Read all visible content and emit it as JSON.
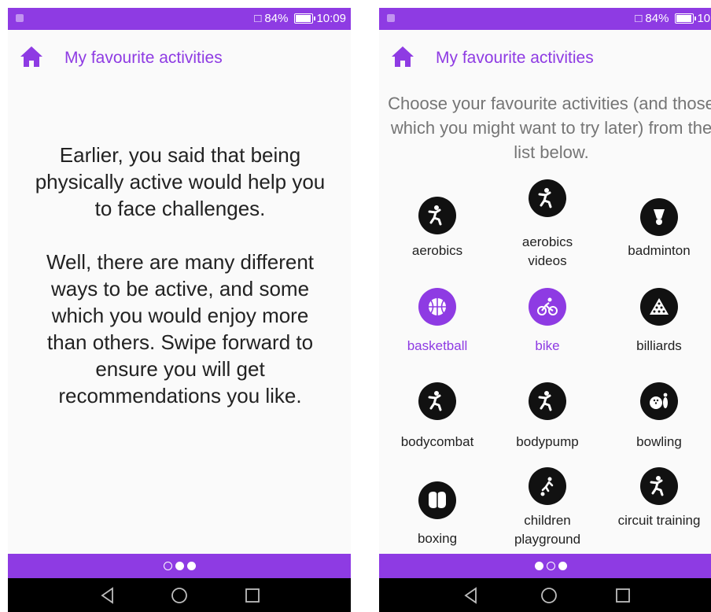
{
  "status_bar": {
    "battery": "84%",
    "time": "10:09"
  },
  "left_screen": {
    "title": "My favourite activities",
    "paragraph_1": "Earlier, you said that being physically active would help you to face challenges.",
    "paragraph_2": "Well, there are many different ways to be active, and some which you would enjoy more than others. Swipe forward to ensure you will get recommendations you like.",
    "pager_active_index": 0
  },
  "right_screen": {
    "title": "My favourite activities",
    "instruction": "Choose your favourite activities (and those which you might want to try later) from the list below.",
    "activities": [
      {
        "label": "aerobics",
        "icon": "aerobics-icon",
        "selected": false
      },
      {
        "label": "aerobics videos",
        "icon": "aerobics-icon",
        "selected": false
      },
      {
        "label": "badminton",
        "icon": "shuttlecock-icon",
        "selected": false
      },
      {
        "label": "basketball",
        "icon": "basketball-icon",
        "selected": true
      },
      {
        "label": "bike",
        "icon": "bike-icon",
        "selected": true
      },
      {
        "label": "billiards",
        "icon": "billiards-icon",
        "selected": false
      },
      {
        "label": "bodycombat",
        "icon": "aerobics-icon",
        "selected": false
      },
      {
        "label": "bodypump",
        "icon": "aerobics-icon",
        "selected": false
      },
      {
        "label": "bowling",
        "icon": "bowling-icon",
        "selected": false
      },
      {
        "label": "boxing",
        "icon": "boxing-gloves-icon",
        "selected": false
      },
      {
        "label": "children playground",
        "icon": "child-playing-icon",
        "selected": false
      },
      {
        "label": "circuit training",
        "icon": "aerobics-icon",
        "selected": false
      }
    ],
    "pager_active_index": 1
  },
  "colors": {
    "accent": "#8e3be3",
    "icon_dark": "#111111",
    "nav_bar": "#000000"
  }
}
